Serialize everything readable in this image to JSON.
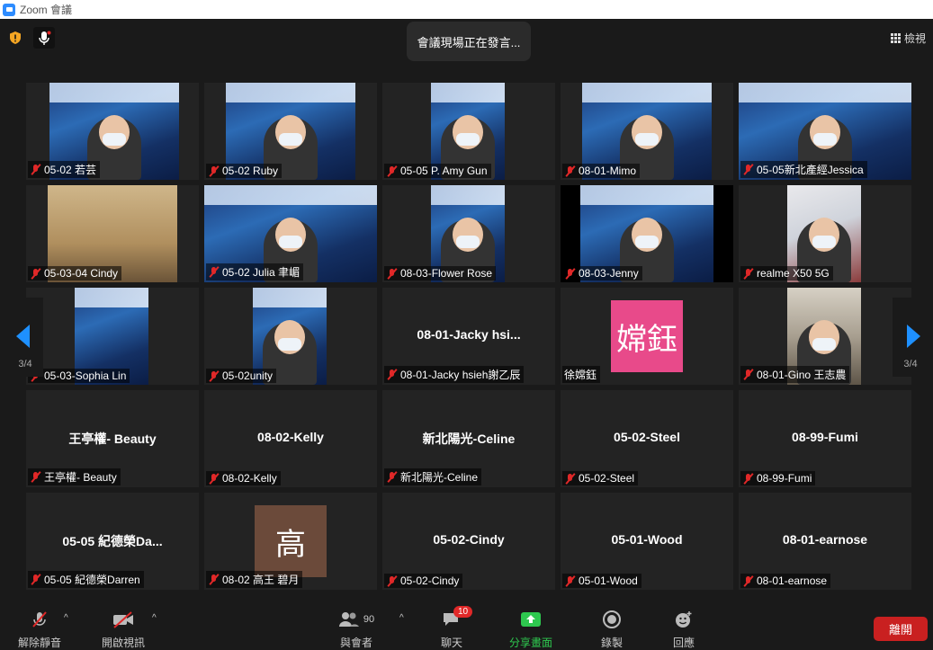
{
  "window": {
    "title": "Zoom 會議"
  },
  "top": {
    "speaking_text": "會議現場正在發言...",
    "view_label": "檢視"
  },
  "nav": {
    "left_page": "3/4",
    "right_page": "3/4"
  },
  "participants": [
    {
      "label": "05-02 若芸",
      "center": ""
    },
    {
      "label": "05-02 Ruby",
      "center": ""
    },
    {
      "label": "05-05 P. Amy Gun",
      "center": ""
    },
    {
      "label": "08-01-Mimo",
      "center": ""
    },
    {
      "label": "05-05新北產經Jessica",
      "center": ""
    },
    {
      "label": "05-03-04 Cindy",
      "center": ""
    },
    {
      "label": "05-02 Julia  聿嵋",
      "center": ""
    },
    {
      "label": "08-03-Flower Rose",
      "center": ""
    },
    {
      "label": "08-03-Jenny",
      "center": ""
    },
    {
      "label": "realme X50 5G",
      "center": ""
    },
    {
      "label": "05-03-Sophia Lin",
      "center": ""
    },
    {
      "label": "05-02unity",
      "center": ""
    },
    {
      "label": "08-01-Jacky hsieh謝乙辰",
      "center": "08-01-Jacky hsi..."
    },
    {
      "label": "徐嫦鈺",
      "center": "",
      "avatar_text": "嫦鈺",
      "avatar_color": "#e84a8a"
    },
    {
      "label": "08-01-Gino 王志農",
      "center": ""
    },
    {
      "label": "王亭權- Beauty",
      "center": "王亭權- Beauty"
    },
    {
      "label": "08-02-Kelly",
      "center": "08-02-Kelly"
    },
    {
      "label": "新北陽光-Celine",
      "center": "新北陽光-Celine"
    },
    {
      "label": "05-02-Steel",
      "center": "05-02-Steel"
    },
    {
      "label": "08-99-Fumi",
      "center": "08-99-Fumi"
    },
    {
      "label": "05-05 紀德榮Darren",
      "center": "05-05 紀德榮Da..."
    },
    {
      "label": "08-02 高王 碧月",
      "center": "",
      "avatar_text": "高",
      "avatar_color": "#6b4a3a"
    },
    {
      "label": "05-02-Cindy",
      "center": "05-02-Cindy"
    },
    {
      "label": "05-01-Wood",
      "center": "05-01-Wood"
    },
    {
      "label": "08-01-earnose",
      "center": "08-01-earnose"
    }
  ],
  "toolbar": {
    "unmute": "解除靜音",
    "start_video": "開啟視訊",
    "participants": "與會者",
    "participants_count": "90",
    "chat": "聊天",
    "chat_badge": "10",
    "share": "分享畫面",
    "record": "錄製",
    "reactions": "回應",
    "leave": "離開"
  },
  "colors": {
    "share_green": "#2ec84f",
    "leave_red": "#c92020",
    "accent_blue": "#2d8cff"
  }
}
